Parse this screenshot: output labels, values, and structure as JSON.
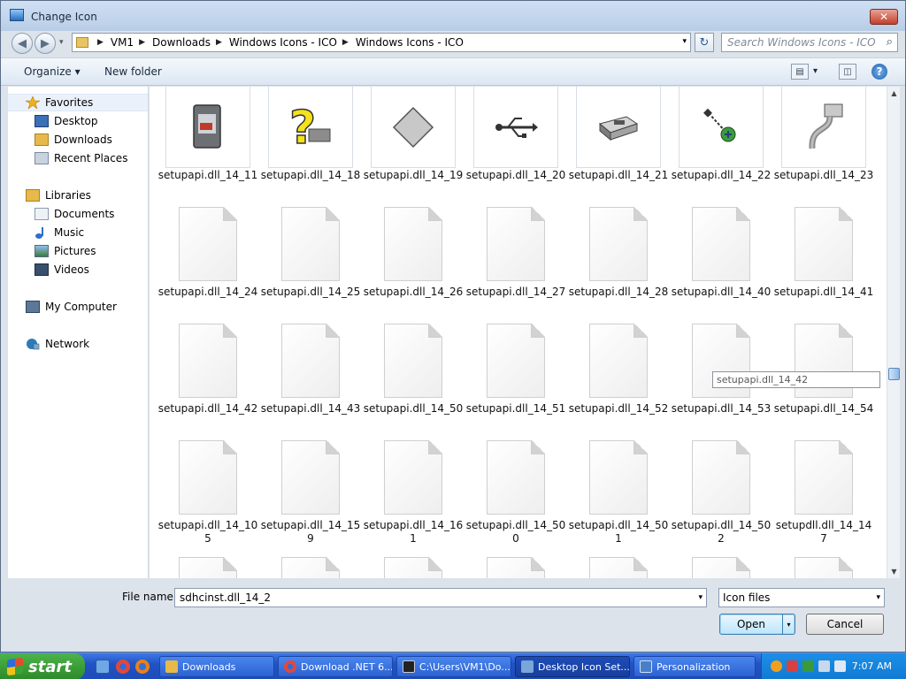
{
  "window": {
    "title": "Change Icon",
    "close_glyph": "✕"
  },
  "nav": {
    "back_glyph": "◀",
    "forward_glyph": "▶",
    "dropdown_glyph": "▾"
  },
  "address": {
    "crumbs": [
      "VM1",
      "Downloads",
      "Windows Icons - ICO",
      "Windows Icons - ICO"
    ],
    "separator_glyph": "▶",
    "dropdown_glyph": "▾"
  },
  "refresh_glyph": "↻",
  "search": {
    "placeholder": "Search Windows Icons - ICO",
    "icon": "magnifier-icon",
    "glyph": "⌕"
  },
  "toolbar": {
    "organize_label": "Organize ▾",
    "new_folder_label": "New folder",
    "views_glyph": "▤",
    "views_drop_glyph": "▾",
    "preview_glyph": "◫",
    "help_glyph": "?"
  },
  "sidebar": {
    "items": [
      {
        "label": "Favorites",
        "icon": "star-icon",
        "color": "#f2b01e"
      },
      {
        "label": "Desktop",
        "icon": "desktop-icon",
        "color": "#3b6fb6"
      },
      {
        "label": "Downloads",
        "icon": "downloads-folder-icon",
        "color": "#e6b94a"
      },
      {
        "label": "Recent Places",
        "icon": "recent-places-icon",
        "color": "#8a9bb2"
      },
      {
        "label": "Libraries",
        "icon": "libraries-icon",
        "color": "#e6b94a"
      },
      {
        "label": "Documents",
        "icon": "documents-icon",
        "color": "#b8c6d8"
      },
      {
        "label": "Music",
        "icon": "music-icon",
        "color": "#2f6fc9"
      },
      {
        "label": "Pictures",
        "icon": "pictures-icon",
        "color": "#5f8fc4"
      },
      {
        "label": "Videos",
        "icon": "videos-icon",
        "color": "#3a4f6b"
      },
      {
        "label": "My Computer",
        "icon": "computer-icon",
        "color": "#5b7899"
      },
      {
        "label": "Network",
        "icon": "network-icon",
        "color": "#2e7ab8"
      }
    ]
  },
  "files": [
    {
      "name": "setupapi.dll_14_11",
      "icon": "smart-card-icon"
    },
    {
      "name": "setupapi.dll_14_18",
      "icon": "question-mark-icon"
    },
    {
      "name": "setupapi.dll_14_19",
      "icon": "gray-diamond-icon"
    },
    {
      "name": "setupapi.dll_14_20",
      "icon": "usb-symbol-icon"
    },
    {
      "name": "setupapi.dll_14_21",
      "icon": "usb-port-icon"
    },
    {
      "name": "setupapi.dll_14_22",
      "icon": "network-plug-icon"
    },
    {
      "name": "setupapi.dll_14_23",
      "icon": "serial-cable-icon"
    },
    {
      "name": "setupapi.dll_14_24",
      "icon": "blank-file-icon"
    },
    {
      "name": "setupapi.dll_14_25",
      "icon": "blank-file-icon"
    },
    {
      "name": "setupapi.dll_14_26",
      "icon": "blank-file-icon"
    },
    {
      "name": "setupapi.dll_14_27",
      "icon": "blank-file-icon"
    },
    {
      "name": "setupapi.dll_14_28",
      "icon": "blank-file-icon"
    },
    {
      "name": "setupapi.dll_14_40",
      "icon": "blank-file-icon"
    },
    {
      "name": "setupapi.dll_14_41",
      "icon": "blank-file-icon"
    },
    {
      "name": "setupapi.dll_14_42",
      "icon": "blank-file-icon"
    },
    {
      "name": "setupapi.dll_14_43",
      "icon": "blank-file-icon"
    },
    {
      "name": "setupapi.dll_14_50",
      "icon": "blank-file-icon"
    },
    {
      "name": "setupapi.dll_14_51",
      "icon": "blank-file-icon"
    },
    {
      "name": "setupapi.dll_14_52",
      "icon": "blank-file-icon"
    },
    {
      "name": "setupapi.dll_14_53",
      "icon": "blank-file-icon"
    },
    {
      "name": "setupapi.dll_14_54",
      "icon": "blank-file-icon"
    },
    {
      "name": "setupapi.dll_14_105",
      "icon": "blank-file-icon"
    },
    {
      "name": "setupapi.dll_14_159",
      "icon": "blank-file-icon"
    },
    {
      "name": "setupapi.dll_14_161",
      "icon": "blank-file-icon"
    },
    {
      "name": "setupapi.dll_14_500",
      "icon": "blank-file-icon"
    },
    {
      "name": "setupapi.dll_14_501",
      "icon": "blank-file-icon"
    },
    {
      "name": "setupapi.dll_14_502",
      "icon": "blank-file-icon"
    },
    {
      "name": "setupdll.dll_14_147",
      "icon": "blank-file-icon"
    },
    {
      "name": "",
      "icon": "blank-file-icon"
    },
    {
      "name": "",
      "icon": "blank-file-icon"
    },
    {
      "name": "",
      "icon": "blank-file-icon"
    },
    {
      "name": "",
      "icon": "blank-file-icon"
    },
    {
      "name": "",
      "icon": "blank-file-icon"
    },
    {
      "name": "",
      "icon": "blank-file-icon"
    },
    {
      "name": "",
      "icon": "blank-file-icon"
    }
  ],
  "tooltip": {
    "text": "setupapi.dll_14_42"
  },
  "scrollbar": {
    "up_glyph": "▲",
    "down_glyph": "▼"
  },
  "footer": {
    "file_name_label": "File name:",
    "file_name_value": "sdhcinst.dll_14_2",
    "file_type_value": "Icon files",
    "dropdown_glyph": "▾",
    "open_label": "Open",
    "open_split_glyph": "▾",
    "cancel_label": "Cancel"
  },
  "taskbar": {
    "start_label": "start",
    "quick_launch": [
      {
        "icon": "show-desktop-icon",
        "color": "#6fa8e6"
      },
      {
        "icon": "chrome-icon",
        "color": "#e0483a"
      },
      {
        "icon": "firefox-icon",
        "color": "#e8801a"
      }
    ],
    "tasks": [
      {
        "label": "Downloads",
        "icon": "folder-icon",
        "color": "#e6b94a"
      },
      {
        "label": "Download .NET 6....",
        "icon": "chrome-icon",
        "color": "#e0483a"
      },
      {
        "label": "C:\\Users\\VM1\\Do...",
        "icon": "7zip-icon",
        "color": "#222222"
      },
      {
        "label": "Desktop Icon Set...",
        "icon": "desktop-settings-icon",
        "color": "#7aa6d8"
      },
      {
        "label": "Personalization",
        "icon": "personalization-icon",
        "color": "#4a7fc7"
      }
    ],
    "tray_icons": [
      {
        "icon": "search-tray-icon",
        "color": "#f0a020"
      },
      {
        "icon": "security-tray-icon",
        "color": "#d94040"
      },
      {
        "icon": "antivirus-tray-icon",
        "color": "#3a9a3a"
      },
      {
        "icon": "network-tray-icon",
        "color": "#c9d8ea"
      },
      {
        "icon": "volume-tray-icon",
        "color": "#dfe8f3"
      }
    ],
    "clock": "7:07 AM"
  },
  "colors": {
    "accent": "#3c7fb1",
    "taskbar": "#2253c4",
    "start": "#3ba435"
  }
}
